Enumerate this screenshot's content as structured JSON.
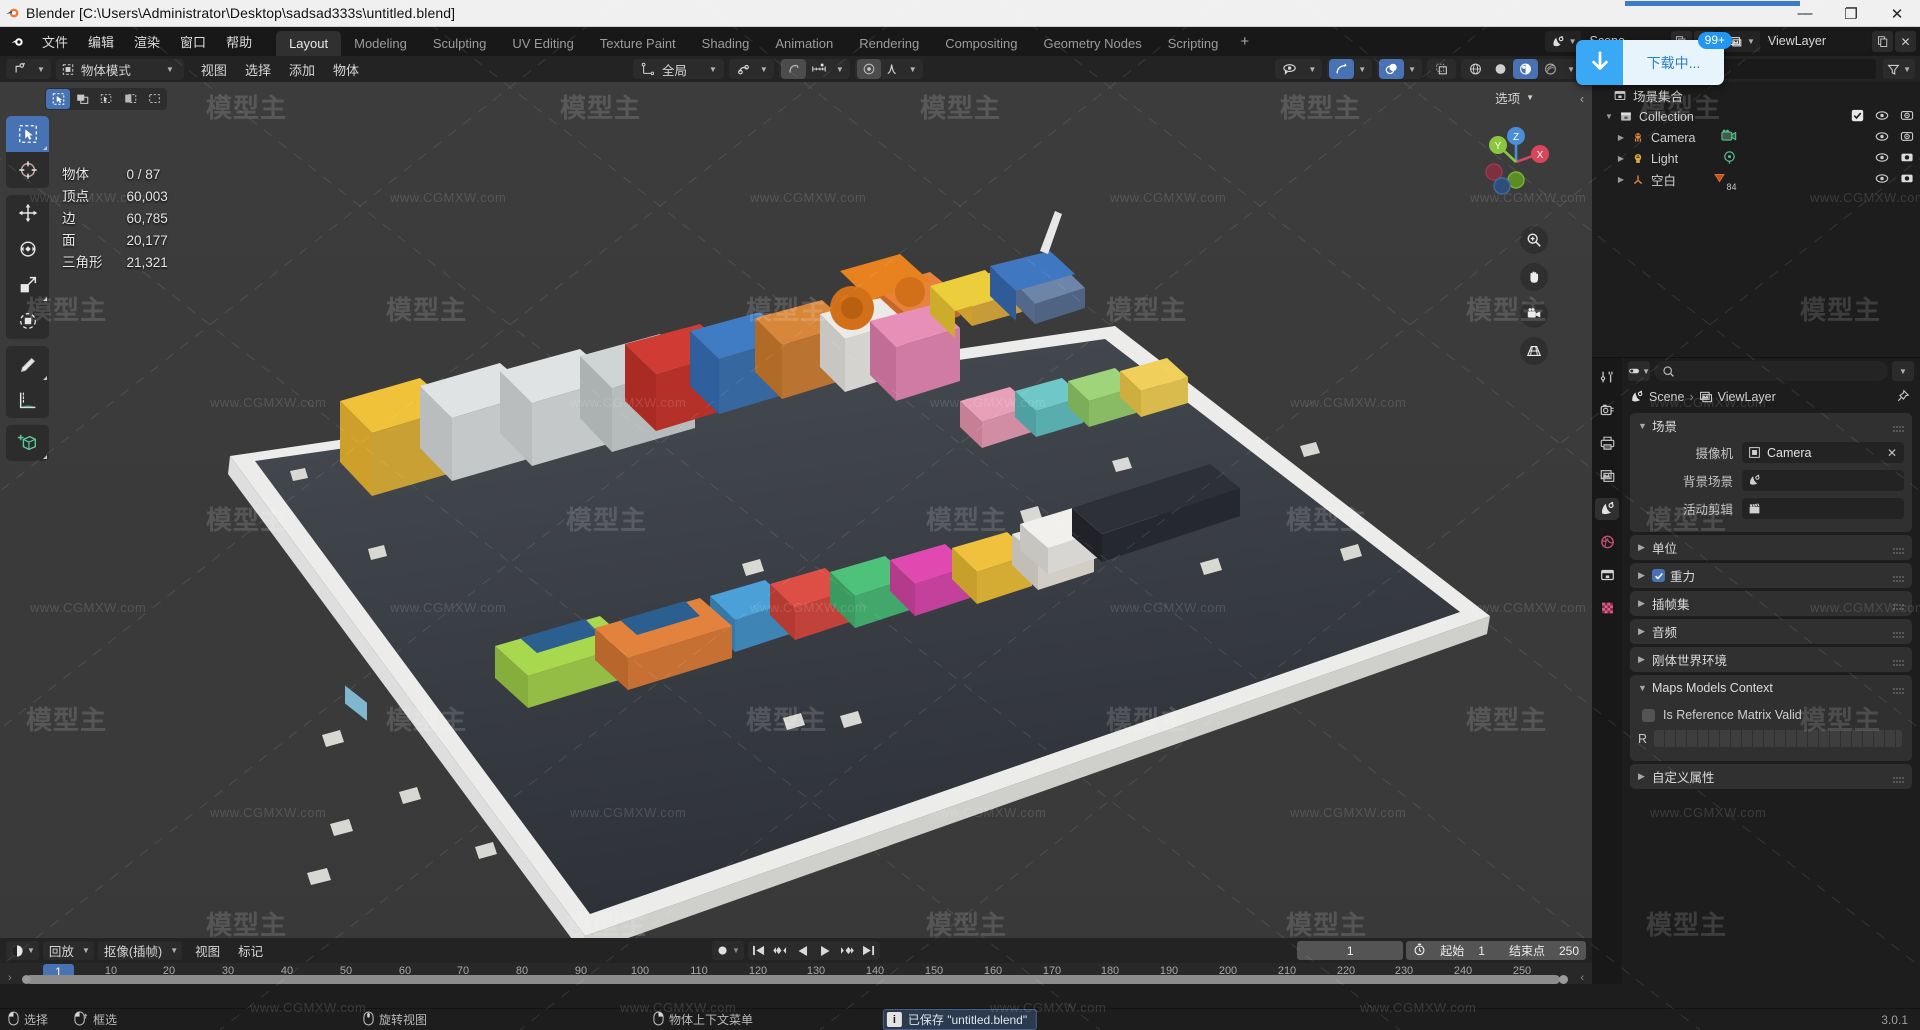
{
  "window": {
    "title": "Blender [C:\\Users\\Administrator\\Desktop\\sadsad333s\\untitled.blend]",
    "minimize": "—",
    "maximize": "❐",
    "close": "✕"
  },
  "topbar": {
    "menus": [
      "文件",
      "编辑",
      "渲染",
      "窗口",
      "帮助"
    ],
    "workspaces": [
      "Layout",
      "Modeling",
      "Sculpting",
      "UV Editing",
      "Texture Paint",
      "Shading",
      "Animation",
      "Rendering",
      "Compositing",
      "Geometry Nodes",
      "Scripting"
    ],
    "active_workspace": "Layout",
    "add_workspace": "+",
    "scene_name": "Scene",
    "viewlayer_name": "ViewLayer"
  },
  "download_popup": {
    "label": "下载中...",
    "badge": "99+",
    "icon": "download-arrow-icon"
  },
  "viewport": {
    "mode": "物体模式",
    "menus": [
      "视图",
      "选择",
      "添加",
      "物体"
    ],
    "transform_orientation": "全局",
    "options_label": "选项",
    "select_modes": [
      "tweak-select-icon",
      "box-select-icon",
      "circle-select-icon",
      "lasso-select-icon",
      "extend-select-icon"
    ],
    "tools": [
      "select-box-tool",
      "cursor-tool",
      "move-tool",
      "rotate-tool",
      "scale-tool",
      "transform-tool",
      "annotate-tool",
      "measure-tool",
      "add-cube-tool"
    ],
    "stats": [
      {
        "label": "物体",
        "value": "0 / 87"
      },
      {
        "label": "顶点",
        "value": "60,003"
      },
      {
        "label": "边",
        "value": "60,785"
      },
      {
        "label": "面",
        "value": "20,177"
      },
      {
        "label": "三角形",
        "value": "21,321"
      }
    ],
    "gizmo_axes": [
      "X",
      "Y",
      "Z"
    ]
  },
  "outliner": {
    "filter_icon": "filter-icon",
    "root": "场景集合",
    "items": [
      {
        "label": "Collection",
        "icon": "collection-icon",
        "indent": 0,
        "expanded": true,
        "checkbox": true,
        "eye": true,
        "camera": true
      },
      {
        "label": "Camera",
        "icon": "camera-object-icon",
        "indent": 1,
        "expanded": false,
        "data_icon": "camera-data-icon",
        "eye": true,
        "camera": true
      },
      {
        "label": "Light",
        "icon": "light-object-icon",
        "indent": 1,
        "expanded": false,
        "data_icon": "light-data-icon",
        "eye": true,
        "camera": true
      },
      {
        "label": "空白",
        "icon": "empty-object-icon",
        "indent": 1,
        "expanded": false,
        "data_icon": "empty-data-icon",
        "badge": "84",
        "eye": true,
        "camera": true
      }
    ]
  },
  "properties": {
    "breadcrumb": [
      "Scene",
      "ViewLayer"
    ],
    "tabs": [
      "tool-icon",
      "render-icon",
      "output-icon",
      "viewlayer-icon",
      "scene-icon",
      "world-icon",
      "collection-icon",
      "texture-icon"
    ],
    "active_tab": "scene-icon",
    "panels": [
      {
        "title": "场景",
        "expanded": true,
        "rows": [
          {
            "label": "摄像机",
            "value": "Camera",
            "icon": "camera-icon",
            "clearable": true
          },
          {
            "label": "背景场景",
            "value": "",
            "icon": "scene-icon",
            "clearable": false
          },
          {
            "label": "活动剪辑",
            "value": "",
            "icon": "clip-icon",
            "clearable": false
          }
        ]
      },
      {
        "title": "单位",
        "expanded": false
      },
      {
        "title": "重力",
        "expanded": false,
        "checkbox": true
      },
      {
        "title": "插帧集",
        "expanded": false
      },
      {
        "title": "音频",
        "expanded": false
      },
      {
        "title": "刚体世界环境",
        "expanded": false
      },
      {
        "title": "Maps Models Context",
        "expanded": true,
        "checkbox_row": {
          "label": "Is Reference Matrix Valid",
          "checked": false
        },
        "matrix_row": {
          "label": "R"
        }
      },
      {
        "title": "自定义属性",
        "expanded": false
      }
    ]
  },
  "timeline": {
    "editor_type": "playback-icon",
    "menus": [
      "回放",
      "抠像(插帧)",
      "视图",
      "标记"
    ],
    "dropdowns": [
      "回放",
      "抠像(插帧)"
    ],
    "plain_menus": [
      "视图",
      "标记"
    ],
    "transport": [
      "jump-start",
      "prev-keyframe",
      "play-reverse",
      "play",
      "next-keyframe",
      "jump-end"
    ],
    "current_frame": "1",
    "start_label": "起始",
    "start_value": "1",
    "end_label": "结束点",
    "end_value": "250",
    "ticks": [
      1,
      10,
      20,
      30,
      40,
      50,
      60,
      70,
      80,
      90,
      100,
      110,
      120,
      130,
      140,
      150,
      160,
      170,
      180,
      190,
      200,
      210,
      220,
      230,
      240,
      250
    ],
    "playhead_frame": "1"
  },
  "statusbar": {
    "hints": [
      {
        "icon": "mouse-left-icon",
        "label": "选择"
      },
      {
        "icon": "mouse-drag-icon",
        "label": "框选"
      },
      {
        "icon": "mouse-middle-icon",
        "label": "旋转视图"
      },
      {
        "icon": "mouse-right-icon",
        "label": "物体上下文菜单"
      }
    ],
    "report": "已保存 \"untitled.blend\"",
    "version": "3.0.1"
  },
  "watermarks": {
    "brand": "模型主",
    "url": "www.CGMXW.com"
  },
  "colors": {
    "accent_blue": "#4772b3",
    "download_blue": "#3aa9f5",
    "badge_blue": "#2196f3",
    "panel_bg": "#303030",
    "editor_bg": "#1d1d1d",
    "header_bg": "#232323",
    "viewport_bg": "#3b3b3b"
  }
}
